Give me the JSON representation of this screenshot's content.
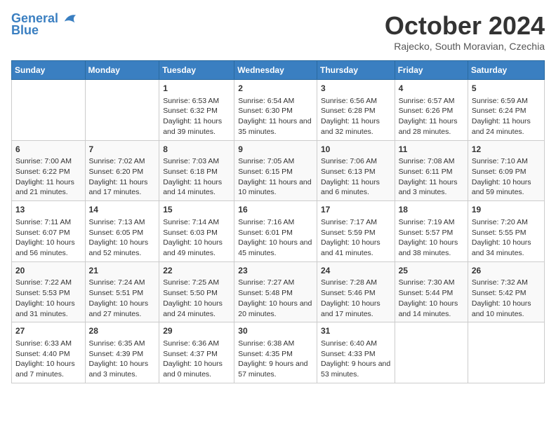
{
  "header": {
    "logo_line1": "General",
    "logo_line2": "Blue",
    "month": "October 2024",
    "location": "Rajecko, South Moravian, Czechia"
  },
  "days_of_week": [
    "Sunday",
    "Monday",
    "Tuesday",
    "Wednesday",
    "Thursday",
    "Friday",
    "Saturday"
  ],
  "weeks": [
    [
      {
        "day": "",
        "info": ""
      },
      {
        "day": "",
        "info": ""
      },
      {
        "day": "1",
        "info": "Sunrise: 6:53 AM\nSunset: 6:32 PM\nDaylight: 11 hours and 39 minutes."
      },
      {
        "day": "2",
        "info": "Sunrise: 6:54 AM\nSunset: 6:30 PM\nDaylight: 11 hours and 35 minutes."
      },
      {
        "day": "3",
        "info": "Sunrise: 6:56 AM\nSunset: 6:28 PM\nDaylight: 11 hours and 32 minutes."
      },
      {
        "day": "4",
        "info": "Sunrise: 6:57 AM\nSunset: 6:26 PM\nDaylight: 11 hours and 28 minutes."
      },
      {
        "day": "5",
        "info": "Sunrise: 6:59 AM\nSunset: 6:24 PM\nDaylight: 11 hours and 24 minutes."
      }
    ],
    [
      {
        "day": "6",
        "info": "Sunrise: 7:00 AM\nSunset: 6:22 PM\nDaylight: 11 hours and 21 minutes."
      },
      {
        "day": "7",
        "info": "Sunrise: 7:02 AM\nSunset: 6:20 PM\nDaylight: 11 hours and 17 minutes."
      },
      {
        "day": "8",
        "info": "Sunrise: 7:03 AM\nSunset: 6:18 PM\nDaylight: 11 hours and 14 minutes."
      },
      {
        "day": "9",
        "info": "Sunrise: 7:05 AM\nSunset: 6:15 PM\nDaylight: 11 hours and 10 minutes."
      },
      {
        "day": "10",
        "info": "Sunrise: 7:06 AM\nSunset: 6:13 PM\nDaylight: 11 hours and 6 minutes."
      },
      {
        "day": "11",
        "info": "Sunrise: 7:08 AM\nSunset: 6:11 PM\nDaylight: 11 hours and 3 minutes."
      },
      {
        "day": "12",
        "info": "Sunrise: 7:10 AM\nSunset: 6:09 PM\nDaylight: 10 hours and 59 minutes."
      }
    ],
    [
      {
        "day": "13",
        "info": "Sunrise: 7:11 AM\nSunset: 6:07 PM\nDaylight: 10 hours and 56 minutes."
      },
      {
        "day": "14",
        "info": "Sunrise: 7:13 AM\nSunset: 6:05 PM\nDaylight: 10 hours and 52 minutes."
      },
      {
        "day": "15",
        "info": "Sunrise: 7:14 AM\nSunset: 6:03 PM\nDaylight: 10 hours and 49 minutes."
      },
      {
        "day": "16",
        "info": "Sunrise: 7:16 AM\nSunset: 6:01 PM\nDaylight: 10 hours and 45 minutes."
      },
      {
        "day": "17",
        "info": "Sunrise: 7:17 AM\nSunset: 5:59 PM\nDaylight: 10 hours and 41 minutes."
      },
      {
        "day": "18",
        "info": "Sunrise: 7:19 AM\nSunset: 5:57 PM\nDaylight: 10 hours and 38 minutes."
      },
      {
        "day": "19",
        "info": "Sunrise: 7:20 AM\nSunset: 5:55 PM\nDaylight: 10 hours and 34 minutes."
      }
    ],
    [
      {
        "day": "20",
        "info": "Sunrise: 7:22 AM\nSunset: 5:53 PM\nDaylight: 10 hours and 31 minutes."
      },
      {
        "day": "21",
        "info": "Sunrise: 7:24 AM\nSunset: 5:51 PM\nDaylight: 10 hours and 27 minutes."
      },
      {
        "day": "22",
        "info": "Sunrise: 7:25 AM\nSunset: 5:50 PM\nDaylight: 10 hours and 24 minutes."
      },
      {
        "day": "23",
        "info": "Sunrise: 7:27 AM\nSunset: 5:48 PM\nDaylight: 10 hours and 20 minutes."
      },
      {
        "day": "24",
        "info": "Sunrise: 7:28 AM\nSunset: 5:46 PM\nDaylight: 10 hours and 17 minutes."
      },
      {
        "day": "25",
        "info": "Sunrise: 7:30 AM\nSunset: 5:44 PM\nDaylight: 10 hours and 14 minutes."
      },
      {
        "day": "26",
        "info": "Sunrise: 7:32 AM\nSunset: 5:42 PM\nDaylight: 10 hours and 10 minutes."
      }
    ],
    [
      {
        "day": "27",
        "info": "Sunrise: 6:33 AM\nSunset: 4:40 PM\nDaylight: 10 hours and 7 minutes."
      },
      {
        "day": "28",
        "info": "Sunrise: 6:35 AM\nSunset: 4:39 PM\nDaylight: 10 hours and 3 minutes."
      },
      {
        "day": "29",
        "info": "Sunrise: 6:36 AM\nSunset: 4:37 PM\nDaylight: 10 hours and 0 minutes."
      },
      {
        "day": "30",
        "info": "Sunrise: 6:38 AM\nSunset: 4:35 PM\nDaylight: 9 hours and 57 minutes."
      },
      {
        "day": "31",
        "info": "Sunrise: 6:40 AM\nSunset: 4:33 PM\nDaylight: 9 hours and 53 minutes."
      },
      {
        "day": "",
        "info": ""
      },
      {
        "day": "",
        "info": ""
      }
    ]
  ]
}
